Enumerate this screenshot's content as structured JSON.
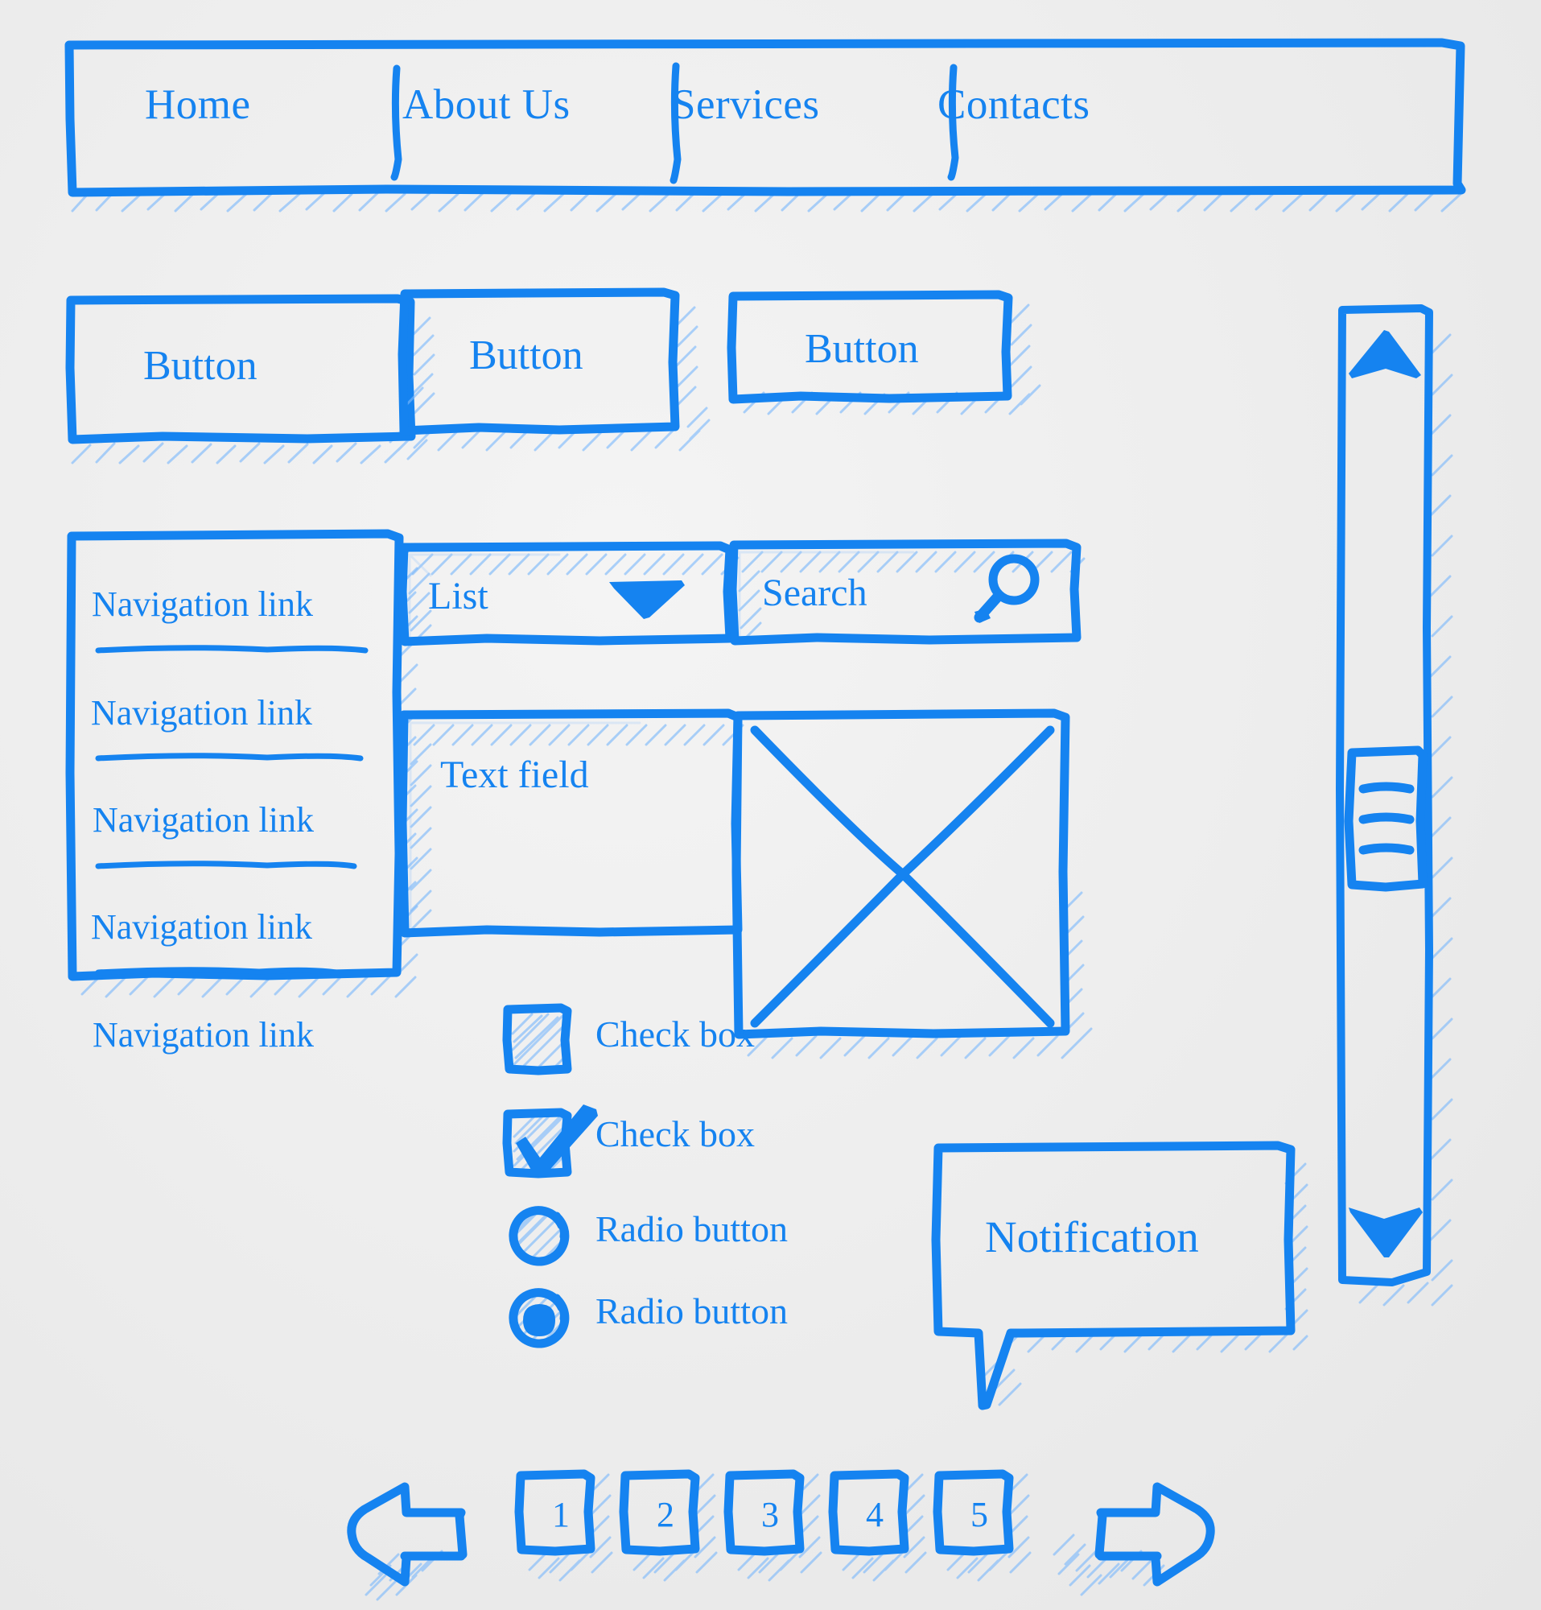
{
  "meta": {
    "accent": "#1583f0",
    "accent_light": "#8dc3fc",
    "background": "#ededed"
  },
  "navbar": {
    "name": "main-navigation",
    "items": [
      {
        "label": "Home"
      },
      {
        "label": "About Us"
      },
      {
        "label": "Services"
      },
      {
        "label": "Contacts"
      }
    ]
  },
  "buttons": [
    {
      "label": "Button"
    },
    {
      "label": "Button"
    },
    {
      "label": "Button"
    }
  ],
  "navigation_list": {
    "items": [
      {
        "label": "Navigation link"
      },
      {
        "label": "Navigation link"
      },
      {
        "label": "Navigation link"
      },
      {
        "label": "Navigation link"
      },
      {
        "label": "Navigation link"
      }
    ]
  },
  "dropdown": {
    "label": "List",
    "icon": "chevron-down-icon"
  },
  "search": {
    "label": "Search",
    "icon": "search-icon"
  },
  "text_field": {
    "label": "Text field"
  },
  "image_placeholder": {
    "icon": "image-placeholder-x-icon"
  },
  "checkboxes": [
    {
      "label": "Check box",
      "checked": false
    },
    {
      "label": "Check box",
      "checked": true
    }
  ],
  "radios": [
    {
      "label": "Radio button",
      "selected": false
    },
    {
      "label": "Radio button",
      "selected": true
    }
  ],
  "notification": {
    "label": "Notification"
  },
  "scrollbar": {
    "up_icon": "triangle-up-icon",
    "down_icon": "triangle-down-icon",
    "thumb_icon": "scrollbar-thumb-grip"
  },
  "pagination": {
    "prev_icon": "arrow-left-icon",
    "next_icon": "arrow-right-icon",
    "pages": [
      {
        "label": "1"
      },
      {
        "label": "2"
      },
      {
        "label": "3"
      },
      {
        "label": "4"
      },
      {
        "label": "5"
      }
    ]
  }
}
